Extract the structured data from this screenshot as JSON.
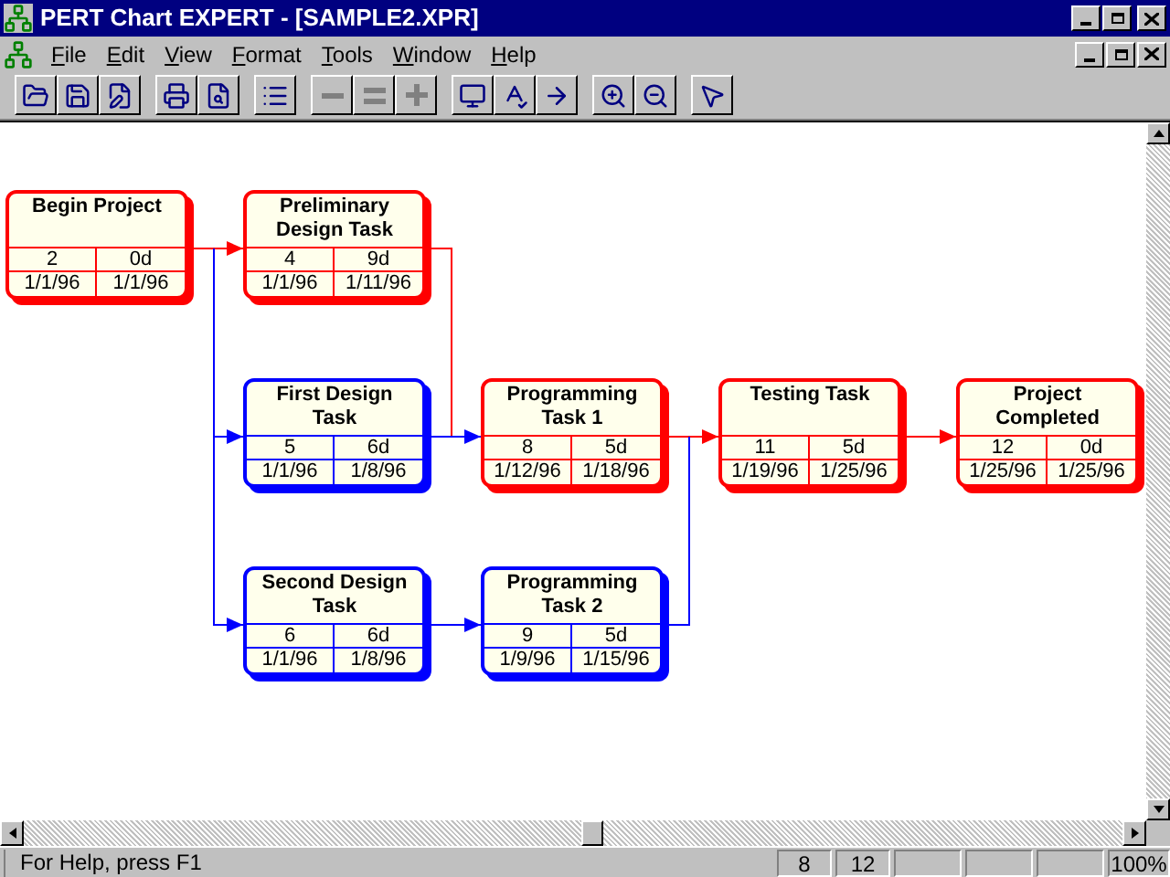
{
  "window": {
    "title": "PERT Chart EXPERT - [SAMPLE2.XPR]"
  },
  "menu": [
    "File",
    "Edit",
    "View",
    "Format",
    "Tools",
    "Window",
    "Help"
  ],
  "toolbar": [
    {
      "disabled": false
    },
    {
      "disabled": false
    },
    {
      "disabled": false
    },
    {
      "disabled": false
    },
    {
      "disabled": false
    },
    {
      "disabled": false
    },
    {
      "disabled": true
    },
    {
      "disabled": true
    },
    {
      "disabled": true
    },
    {
      "disabled": false
    },
    {
      "disabled": false
    },
    {
      "disabled": false
    },
    {
      "disabled": false
    },
    {
      "disabled": false
    },
    {
      "disabled": false
    }
  ],
  "tasks": [
    {
      "name": "Begin Project",
      "number": "2",
      "duration": "0d",
      "start": "1/1/96",
      "finish": "1/1/96",
      "critical": true
    },
    {
      "name": "Preliminary Design Task",
      "number": "4",
      "duration": "9d",
      "start": "1/1/96",
      "finish": "1/11/96",
      "critical": true
    },
    {
      "name": "First Design Task",
      "number": "5",
      "duration": "6d",
      "start": "1/1/96",
      "finish": "1/8/96",
      "critical": false
    },
    {
      "name": "Second Design Task",
      "number": "6",
      "duration": "6d",
      "start": "1/1/96",
      "finish": "1/8/96",
      "critical": false
    },
    {
      "name": "Programming Task 1",
      "number": "8",
      "duration": "5d",
      "start": "1/12/96",
      "finish": "1/18/96",
      "critical": true
    },
    {
      "name": "Programming Task 2",
      "number": "9",
      "duration": "5d",
      "start": "1/9/96",
      "finish": "1/15/96",
      "critical": false
    },
    {
      "name": "Testing Task",
      "number": "11",
      "duration": "5d",
      "start": "1/19/96",
      "finish": "1/25/96",
      "critical": true
    },
    {
      "name": "Project Completed",
      "number": "12",
      "duration": "0d",
      "start": "1/25/96",
      "finish": "1/25/96",
      "critical": true
    }
  ],
  "status_bar": {
    "message": "For Help, press F1",
    "panes": [
      "8",
      "12"
    ],
    "zoom": "100%"
  }
}
